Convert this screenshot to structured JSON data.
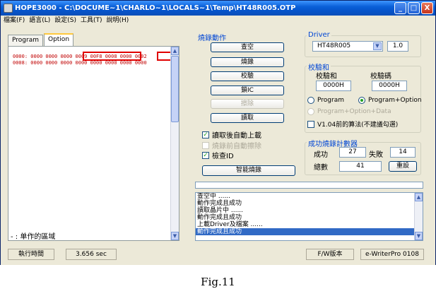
{
  "window": {
    "title": "HOPE3000 - C:\\DOCUME~1\\CHARLO~1\\LOCALS~1\\Temp\\HT48R005.OTP",
    "controls": [
      "_",
      "□",
      "X"
    ]
  },
  "menu": [
    "檔案(F)",
    "語言(L)",
    "設定(S)",
    "工具(T)",
    "說明(H)"
  ],
  "tabs": [
    {
      "label": "Program",
      "active": false
    },
    {
      "label": "Option",
      "active": true
    }
  ],
  "hex": {
    "lines": [
      {
        "address": "0000:",
        "words": [
          "0000",
          "0000",
          "0000",
          "0009",
          "00F8",
          "0008",
          "0000",
          "0002"
        ]
      },
      {
        "address": "0008:",
        "words": [
          "0000",
          "0000",
          "0000",
          "0000",
          "0000",
          "0000",
          "0000",
          "0000"
        ]
      }
    ],
    "region_note": "- : 单作的區域"
  },
  "operations": {
    "title": "燒錄動作",
    "buttons": [
      {
        "label": "查空",
        "enabled": true
      },
      {
        "label": "燒錄",
        "enabled": true
      },
      {
        "label": "校驗",
        "enabled": true
      },
      {
        "label": "鎖IC",
        "enabled": true
      },
      {
        "label": "擦除",
        "enabled": false
      },
      {
        "label": "讀取",
        "enabled": true
      }
    ],
    "checkboxes": [
      {
        "label": "讀取後自動上載",
        "checked": true,
        "enabled": true
      },
      {
        "label": "燒錄前自動擦除",
        "checked": false,
        "enabled": false
      },
      {
        "label": "檢查ID",
        "checked": true,
        "enabled": true
      }
    ],
    "smart_burn_label": "智能燒錄"
  },
  "driver": {
    "title": "Driver",
    "selected": "HT48R005",
    "version": "1.0"
  },
  "checksum": {
    "title": "校驗和",
    "sum_label": "校驗和",
    "code_label": "校驗碼",
    "sum_value": "0000H",
    "code_value": "0000H",
    "options": [
      {
        "label": "Program",
        "selected": false,
        "enabled": true
      },
      {
        "label": "Program+Option",
        "selected": true,
        "enabled": true
      },
      {
        "label": "Program+Option+Data",
        "selected": false,
        "enabled": false
      }
    ],
    "legacy_algo_label": "V1.04前的算法(不建議勾選)"
  },
  "counter": {
    "title": "成功燒錄計數器",
    "success_label": "成功",
    "success_value": "27",
    "fail_label": "失敗",
    "fail_value": "14",
    "total_label": "總數",
    "total_value": "41",
    "reset_label": "重設"
  },
  "log": {
    "lines": [
      "查空中 ......",
      "動作完成且成功",
      "讀取晶片中 ......",
      "動作完成且成功",
      "上載Driver及檔案 ......",
      "動作完成且成功"
    ],
    "selected_index": 5
  },
  "status": {
    "time_label": "執行時間",
    "time_value": "3.656 sec",
    "fw_label": "F/W版本",
    "device": "e-WriterPro 0108"
  },
  "caption": "Fig.11"
}
